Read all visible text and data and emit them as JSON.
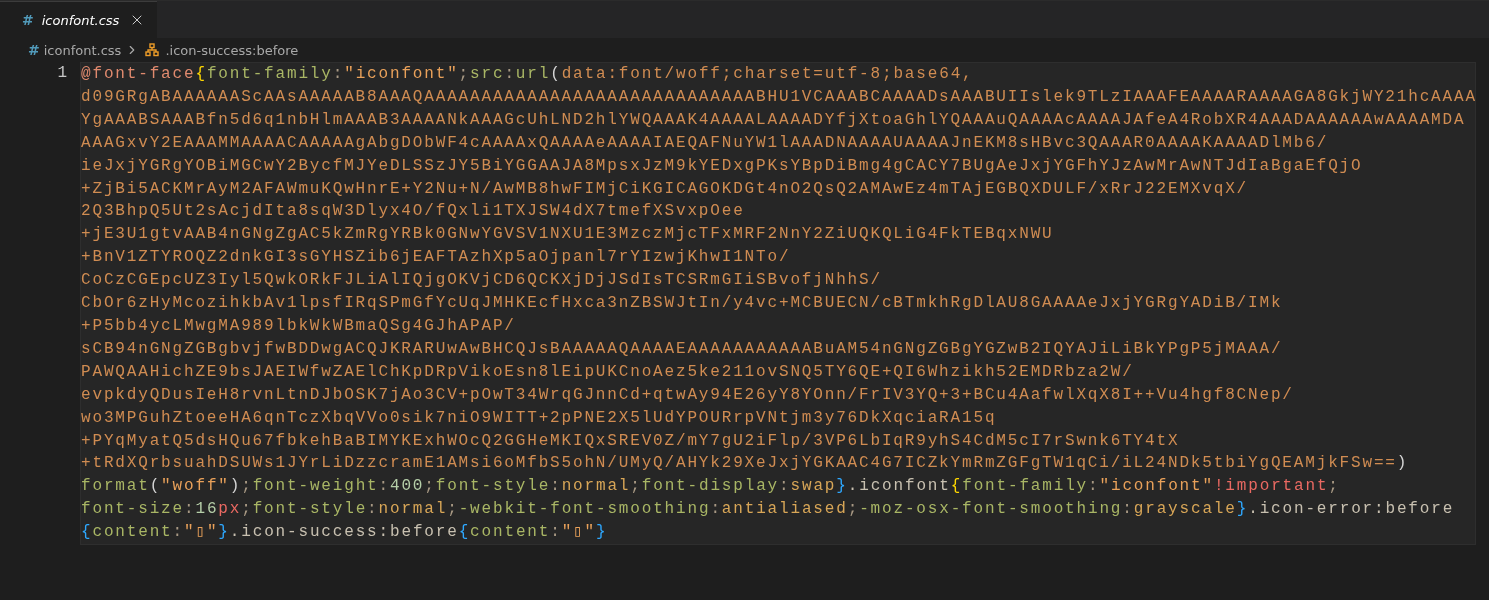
{
  "tab": {
    "icon": "#",
    "label": "iconfont.css",
    "selected": true,
    "preview": true
  },
  "breadcrumb": {
    "icon": "#",
    "file": "iconfont.css",
    "symbol": ".icon-success:before"
  },
  "editor": {
    "line_number": "1",
    "current_line": true,
    "lines": [
      [
        {
          "kind": "atrule",
          "text": "@font-face"
        },
        {
          "kind": "brace1",
          "text": "{"
        },
        {
          "kind": "property",
          "text": "font-family"
        },
        {
          "kind": "punct",
          "text": ":"
        },
        {
          "kind": "string",
          "text": "\"iconfont\""
        },
        {
          "kind": "punct",
          "text": ";"
        },
        {
          "kind": "property",
          "text": "src"
        },
        {
          "kind": "punct",
          "text": ":"
        },
        {
          "kind": "func",
          "text": "url"
        },
        {
          "kind": "paren",
          "text": "("
        },
        {
          "kind": "url",
          "text": "data:font/woff;charset=utf-8;base64,"
        }
      ],
      [
        {
          "kind": "url",
          "text": "d09GRgABAAAAAAScAAsAAAAAB8AAAQAAAAAAAAAAAAAAAAAAAAAAAAAAAAABHU1VCAAABCAAAADsAAABUIIslek9TLzIAAAFEAAAARAAAAGA8GkjWY21hcAAAA"
        }
      ],
      [
        {
          "kind": "url",
          "text": "YgAAABSAAABfn5d6q1nbHlmAAAB3AAAANkAAAGcUhLND2hlYWQAAAK4AAAALAAAADYfjXtoaGhlYQAAAuQAAAAcAAAAJAfeA4RobXR4AAADAAAAAAwAAAAMDA"
        }
      ],
      [
        {
          "kind": "url",
          "text": "AAAGxvY2EAAAMMAAAACAAAAAgAbgDObWF4cAAAAxQAAAAeAAAAIAEQAFNuYW1lAAADNAAAAUAAAAJnEKM8sHBvc3QAAAR0AAAAKAAAADlMb6/"
        }
      ],
      [
        {
          "kind": "url",
          "text": "ieJxjYGRgYOBiMGCwY2BycfMJYeDLSSzJY5BiYGGAAJA8MpsxJzM9kYEDxgPKsYBpDiBmg4gCACY7BUgAeJxjYGFhYJzAwMrAwNTJdIaBgaEfQjO"
        }
      ],
      [
        {
          "kind": "url",
          "text": "+ZjBi5ACKMrAyM2AFAWmuKQwHnrE+Y2Nu+N/AwMB8hwFIMjCiKGICAGOKDGt4nO2QsQ2AMAwEz4mTAjEGBQXDULF/xRrJ22EMXvqX/"
        }
      ],
      [
        {
          "kind": "url",
          "text": "2Q3BhpQ5Ut2sAcjdIta8sqW3Dlyx4O/fQxli1TXJSW4dX7tmefXSvxpOee"
        }
      ],
      [
        {
          "kind": "url",
          "text": "+jE3U1gtvAAB4nGNgZgAC5kZmRgYRBk0GNwYGVSV1NXU1E3MzczMjcTFxMRF2NnY2ZiUQKQLiG4FkTEBqxNWU"
        }
      ],
      [
        {
          "kind": "url",
          "text": "+BnV1ZTYROQZ2dnkGI3sGYHSZib6jEAFTAzhXp5aOjpanl7rYIzwjKhwI1NTo/"
        }
      ],
      [
        {
          "kind": "url",
          "text": "CoCzCGEpcUZ3Iyl5QwkORkFJLiAlIQjgOKVjCD6QCKXjDjJSdIsTCSRmGIiSBvofjNhhS/"
        }
      ],
      [
        {
          "kind": "url",
          "text": "CbOr6zHyMcozihkbAv1lpsfIRqSPmGfYcUqJMHKEcfHxca3nZBSWJtIn/y4vc+MCBUECN/cBTmkhRgDlAU8GAAAAeJxjYGRgYADiB/IMk"
        }
      ],
      [
        {
          "kind": "url",
          "text": "+P5bb4ycLMwgMA989lbkWkWBmaQSg4GJhAPAP/"
        }
      ],
      [
        {
          "kind": "url",
          "text": "sCB94nGNgZGBgbvjfwBDDwgACQJKRARUwAwBHCQJsBAAAAAQAAAAEAAAAAAAAAAABuAM54nGNgZGBgYGZwB2IQYAJiLiBkYPgP5jMAAA/"
        }
      ],
      [
        {
          "kind": "url",
          "text": "PAWQAAHichZE9bsJAEIWfwZAElChKpDRpVikoEsn8lEipUKCnoAez5ke211ovSNQ5TY6QE+QI6Whzikh52EMDRbza2W/"
        }
      ],
      [
        {
          "kind": "url",
          "text": "evpkdyQDusIeH8rvnLtnDJbOSK7jAo3CV+pOwT34WrqGJnnCd+qtwAy94E26yY8YOnn/FrIV3YQ+3+BCu4AafwlXqX8I++Vu4hgf8CNep/"
        }
      ],
      [
        {
          "kind": "url",
          "text": "wo3MPGuhZtoeeHA6qnTczXbqVVo0sik7niO9WITT+2pPNE2X5lUdYPOURrpVNtjm3y76DkXqciaRA15q"
        }
      ],
      [
        {
          "kind": "url",
          "text": "+PYqMyatQ5dsHQu67fbkehBaBIMYKExhWOcQ2GGHeMKIQxSREV0Z/mY7gU2iFlp/3VP6LbIqR9yhS4CdM5cI7rSwnk6TY4tX"
        }
      ],
      [
        {
          "kind": "url",
          "text": "+tRdXQrbsuahDSUWs1JYrLiDzzcramE1AMsi6oMfbS5ohN/UMyQ/AHYk29XeJxjYGKAAC4G7ICZkYmRmZGFgTW1qCi/iL24NDk5tbiYgQEAMjkFSw=="
        },
        {
          "kind": "paren",
          "text": ")"
        }
      ],
      [
        {
          "kind": "func",
          "text": "format"
        },
        {
          "kind": "paren",
          "text": "("
        },
        {
          "kind": "string",
          "text": "\"woff\""
        },
        {
          "kind": "paren",
          "text": ")"
        },
        {
          "kind": "punct",
          "text": ";"
        },
        {
          "kind": "property",
          "text": "font-weight"
        },
        {
          "kind": "punct",
          "text": ":"
        },
        {
          "kind": "number",
          "text": "400"
        },
        {
          "kind": "punct",
          "text": ";"
        },
        {
          "kind": "property",
          "text": "font-style"
        },
        {
          "kind": "punct",
          "text": ":"
        },
        {
          "kind": "value",
          "text": "normal"
        },
        {
          "kind": "punct",
          "text": ";"
        },
        {
          "kind": "property",
          "text": "font-display"
        },
        {
          "kind": "punct",
          "text": ":"
        },
        {
          "kind": "value",
          "text": "swap"
        },
        {
          "kind": "brace2",
          "text": "}"
        },
        {
          "kind": "selector",
          "text": ".iconfont"
        },
        {
          "kind": "brace1",
          "text": "{"
        },
        {
          "kind": "property",
          "text": "font-family"
        },
        {
          "kind": "punct",
          "text": ":"
        },
        {
          "kind": "string",
          "text": "\"iconfont\""
        },
        {
          "kind": "important",
          "text": "!important"
        },
        {
          "kind": "punct",
          "text": ";"
        }
      ],
      [
        {
          "kind": "property",
          "text": "font-size"
        },
        {
          "kind": "punct",
          "text": ":"
        },
        {
          "kind": "number",
          "text": "16"
        },
        {
          "kind": "unit",
          "text": "px"
        },
        {
          "kind": "punct",
          "text": ";"
        },
        {
          "kind": "property",
          "text": "font-style"
        },
        {
          "kind": "punct",
          "text": ":"
        },
        {
          "kind": "value",
          "text": "normal"
        },
        {
          "kind": "punct",
          "text": ";"
        },
        {
          "kind": "property",
          "text": "-webkit-font-smoothing"
        },
        {
          "kind": "punct",
          "text": ":"
        },
        {
          "kind": "value",
          "text": "antialiased"
        },
        {
          "kind": "punct",
          "text": ";"
        },
        {
          "kind": "property",
          "text": "-moz-osx-font-smoothing"
        },
        {
          "kind": "punct",
          "text": ":"
        },
        {
          "kind": "value",
          "text": "grayscale"
        },
        {
          "kind": "brace2",
          "text": "}"
        },
        {
          "kind": "selector",
          "text": ".icon-error:before"
        }
      ],
      [
        {
          "kind": "brace2",
          "text": "{"
        },
        {
          "kind": "property",
          "text": "content"
        },
        {
          "kind": "punct",
          "text": ":"
        },
        {
          "kind": "string",
          "text": "\"▯\""
        },
        {
          "kind": "brace2",
          "text": "}"
        },
        {
          "kind": "selector",
          "text": ".icon-success:before"
        },
        {
          "kind": "brace2",
          "text": "{"
        },
        {
          "kind": "property",
          "text": "content"
        },
        {
          "kind": "punct",
          "text": ":"
        },
        {
          "kind": "string",
          "text": "\"▯\""
        },
        {
          "kind": "brace2",
          "text": "}"
        }
      ]
    ]
  }
}
